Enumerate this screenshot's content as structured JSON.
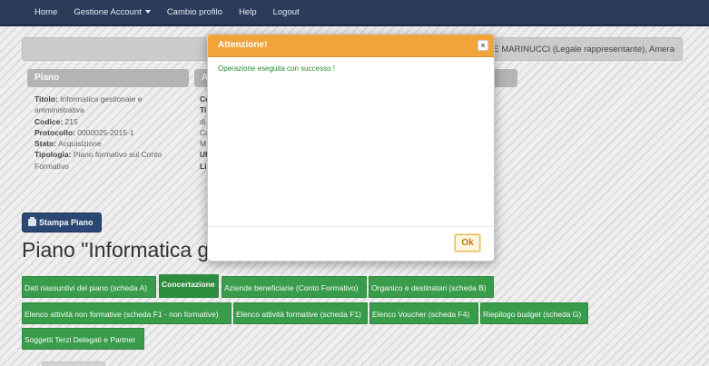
{
  "navbar": {
    "items": [
      "Home",
      "Gestione Account",
      "Cambio profilo",
      "Help",
      "Logout"
    ]
  },
  "userbar": {
    "text": "SE MARINUCCI (Legale rappresentante), Amera"
  },
  "panels": {
    "piano_title": "Piano",
    "second_title_initial": "A"
  },
  "piano_info": {
    "titolo_label": "Titolo:",
    "titolo_value": " Informatica gestionale e amministrativa",
    "codice_label": "Codice:",
    "codice_value": " 215",
    "protocollo_label": "Protocollo:",
    "protocollo_value": " 0000025-2015-1",
    "stato_label": "Stato:",
    "stato_value": " Acquisizione",
    "tipologia_label": "Tipologia:",
    "tipologia_value": " Piano formativo sul Conto Formativo"
  },
  "col2_fragments": [
    "Co",
    "Ti",
    "di",
    "Co",
    "M",
    "Ul",
    "",
    "Li"
  ],
  "print_button": {
    "label": "Stampa Piano"
  },
  "page_title": "Piano \"Informatica g",
  "tabs": [
    "Dati riassuntivi del piano (scheda A)",
    "Concertazione",
    "Aziende beneficiarie (Conto Formativo)",
    "Organico e destinatari (scheda B)",
    "Elenco attività non formative (scheda F1 - non formative)",
    "Elenco attività formative (scheda F1)",
    "Elenco Voucher (scheda F4)",
    "Riepilogo budget (scheda G)",
    "Soggetti Terzi Delegati e Partner"
  ],
  "modal": {
    "title": "Attenzione!",
    "close_label": "×",
    "message": "Operazione eseguita con successo !",
    "ok_label": "Ok"
  },
  "colors": {
    "navbar": "#2c3e5c",
    "modal_header": "#f0a43a",
    "tab_green": "#3aa04c",
    "success_text": "#2a8a2a",
    "print_button": "#2c4a78"
  }
}
